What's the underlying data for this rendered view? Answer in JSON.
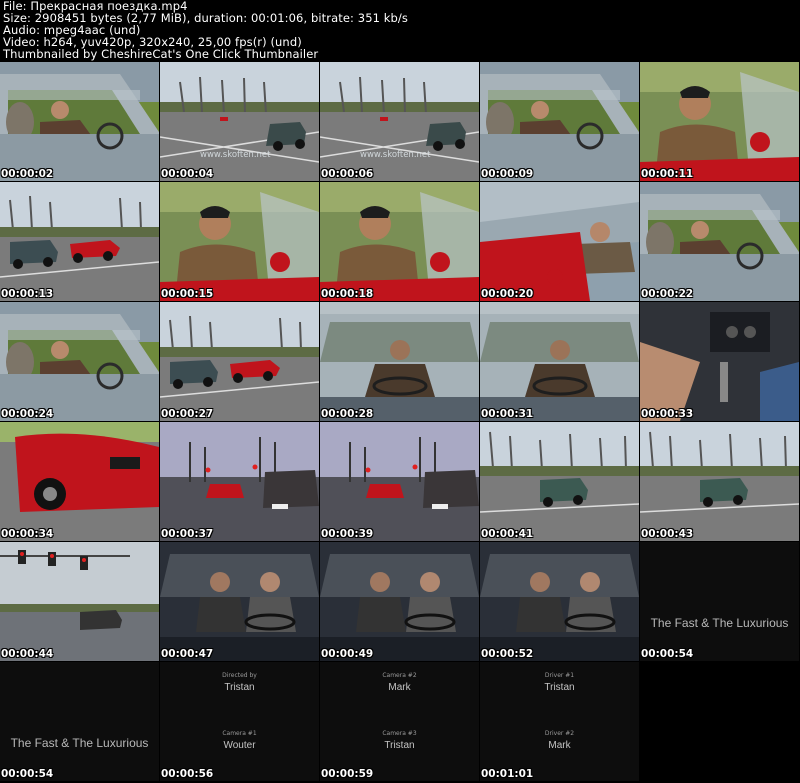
{
  "header": {
    "file": "File: Прекрасная поездка.mp4",
    "size": "Size: 2908451 bytes (2,77 MiB), duration: 00:01:06, bitrate: 351 kb/s",
    "audio": "Audio: mpeg4aac (und)",
    "video": "Video: h264, yuv420p, 320x240, 25,00 fps(r) (und)",
    "credit": "Thumbnailed by CheshireCat's One Click Thumbnailer"
  },
  "watermark": "www.skoften.net",
  "thumbnails": [
    {
      "time": "00:00:02",
      "scene": "car-interior-side"
    },
    {
      "time": "00:00:04",
      "scene": "road-car-watermark"
    },
    {
      "time": "00:00:06",
      "scene": "road-car-watermark"
    },
    {
      "time": "00:00:09",
      "scene": "car-interior-side"
    },
    {
      "time": "00:00:11",
      "scene": "red-convertible-driver"
    },
    {
      "time": "00:00:13",
      "scene": "road-two-cars"
    },
    {
      "time": "00:00:15",
      "scene": "red-convertible-driver"
    },
    {
      "time": "00:00:18",
      "scene": "red-convertible-driver"
    },
    {
      "time": "00:00:20",
      "scene": "red-convertible-side"
    },
    {
      "time": "00:00:22",
      "scene": "car-interior-side"
    },
    {
      "time": "00:00:24",
      "scene": "car-interior-side"
    },
    {
      "time": "00:00:27",
      "scene": "road-two-cars"
    },
    {
      "time": "00:00:28",
      "scene": "windshield-driver"
    },
    {
      "time": "00:00:31",
      "scene": "windshield-driver"
    },
    {
      "time": "00:00:33",
      "scene": "car-footwell"
    },
    {
      "time": "00:00:34",
      "scene": "red-car-rear"
    },
    {
      "time": "00:00:37",
      "scene": "dusk-road"
    },
    {
      "time": "00:00:39",
      "scene": "dusk-road"
    },
    {
      "time": "00:00:41",
      "scene": "road-single-car"
    },
    {
      "time": "00:00:43",
      "scene": "road-single-car"
    },
    {
      "time": "00:00:44",
      "scene": "traffic-lights"
    },
    {
      "time": "00:00:47",
      "scene": "windshield-night"
    },
    {
      "time": "00:00:49",
      "scene": "windshield-night"
    },
    {
      "time": "00:00:52",
      "scene": "windshield-night"
    },
    {
      "time": "00:00:54",
      "scene": "title-card",
      "title": "The Fast & The Luxurious"
    },
    {
      "time": "00:00:54",
      "scene": "title-card",
      "title": "The Fast & The Luxurious"
    },
    {
      "time": "00:00:56",
      "scene": "credits",
      "credits": [
        {
          "role": "Directed by",
          "name": "Tristan"
        },
        {
          "role": "Camera #1",
          "name": "Wouter"
        }
      ]
    },
    {
      "time": "00:00:59",
      "scene": "credits",
      "credits": [
        {
          "role": "Camera #2",
          "name": "Mark"
        },
        {
          "role": "Camera #3",
          "name": "Tristan"
        }
      ]
    },
    {
      "time": "00:01:01",
      "scene": "credits",
      "credits": [
        {
          "role": "Driver #1",
          "name": "Tristan"
        },
        {
          "role": "Driver #2",
          "name": "Mark"
        }
      ]
    }
  ],
  "colors": {
    "background": "#000000",
    "text": "#ffffff",
    "red_car": "#c0141c",
    "sky": "#c9d3dc",
    "grass": "#6f8a3c",
    "road": "#7b7b7b"
  }
}
